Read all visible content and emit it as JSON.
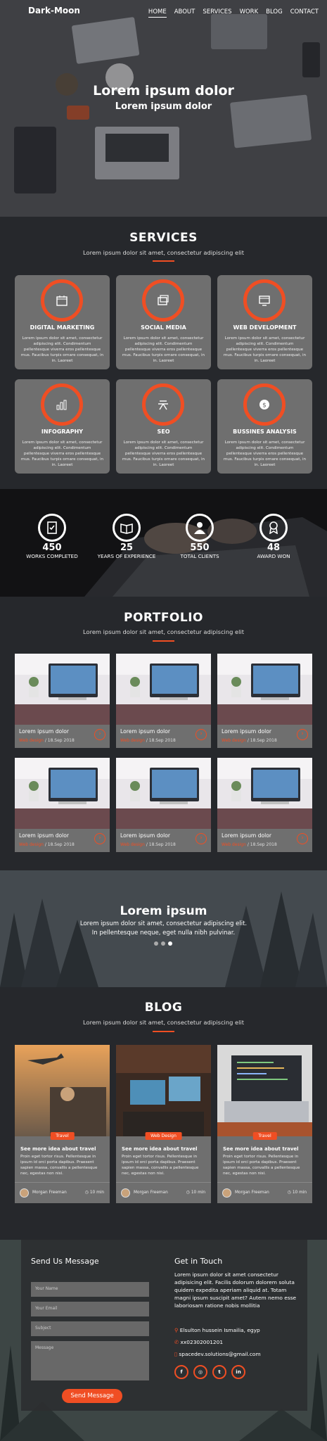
{
  "header": {
    "brand": "Dark-Moon",
    "nav": [
      "HOME",
      "ABOUT",
      "SERVICES",
      "WORK",
      "BLOG",
      "CONTACT"
    ],
    "active_nav": "HOME"
  },
  "hero": {
    "title": "Lorem ipsum dolor",
    "subtitle": "Lorem ipsum dolor"
  },
  "services": {
    "title": "SERVICES",
    "subtitle": "Lorem ipsum dolor sit amet, consectetur adipiscing elit",
    "items": [
      {
        "title": "DIGITAL MARKETING",
        "icon": "calendar-icon"
      },
      {
        "title": "SOCIAL MEDIA",
        "icon": "media-icon"
      },
      {
        "title": "WEB DEVELOPMENT",
        "icon": "monitor-icon"
      },
      {
        "title": "INFOGRAPHY",
        "icon": "bar-chart-icon"
      },
      {
        "title": "SEO",
        "icon": "seo-icon"
      },
      {
        "title": "BUSSINES ANALYSIS",
        "icon": "dollar-gear-icon"
      }
    ],
    "description": "Lorem ipsum dolor sit amet, consectetur adipiscing elit. Condimentum pellentesque viverra eros pellentesque mus. Faucibus turpis ornare consequat, in in. Laoreet"
  },
  "stats": [
    {
      "value": "450",
      "label": "WORKS COMPLETED",
      "icon": "checklist-icon"
    },
    {
      "value": "25",
      "label": "YEARS OF EXPERIENCE",
      "icon": "book-icon"
    },
    {
      "value": "550",
      "label": "TOTAL CLIENTS",
      "icon": "user-icon"
    },
    {
      "value": "48",
      "label": "AWARD WON",
      "icon": "award-icon"
    }
  ],
  "portfolio": {
    "title": "PORTFOLIO",
    "subtitle": "Lorem ipsum dolor sit amet, consectetur adipiscing elit",
    "item_title": "Lorem ipsum dolor",
    "item_category": "Web design",
    "item_date": "/ 18.Sep 2018"
  },
  "testimonial": {
    "title": "Lorem ipsum",
    "line1": "Lorem ipsum dolor sit amet, consectetur adipiscing elit.",
    "line2": "In pellentesque neque, eget nulla nibh pulvinar."
  },
  "blog": {
    "title": "BLOG",
    "subtitle": "Lorem ipsum dolor sit amet, consectetur adipiscing elit",
    "posts": [
      {
        "tag": "Travel",
        "title": "See more idea about travel"
      },
      {
        "tag": "Web Design",
        "title": "See more idea about travel"
      },
      {
        "tag": "Travel",
        "title": "See more idea about travel"
      }
    ],
    "excerpt": "Proin eget tortor risus. Pellentesque in ipsum id orci porta dapibus. Praesent sapien massa, convallis a pellentesque nec, egestas non nisi.",
    "author": "Morgan Freeman",
    "read_time": "10 min"
  },
  "contact": {
    "form_title": "Send Us Message",
    "name_placeholder": "Your Name",
    "email_placeholder": "Your Email",
    "subject_placeholder": "Subject",
    "message_placeholder": "Message",
    "send_label": "Send Message",
    "info_title": "Get in Touch",
    "info_text": "Lorem ipsum dolor sit amet consectetur adipisicing elit. Facilis dolorum dolorem soluta quidem expedita aperiam aliquid at. Totam magni ipsum suscipit amet? Autem nemo esse laboriosam ratione nobis mollitia",
    "address": "Elsulton hussein Ismailia, egyp",
    "phone": "xx02302001201",
    "email": "spacedev.solutions@gmail.com",
    "socials": [
      "facebook-icon",
      "instagram-icon",
      "twitter-icon",
      "linkedin-icon"
    ]
  },
  "colors": {
    "accent": "#f04e23",
    "background": "#26282c",
    "card": "#6f6f6f"
  }
}
